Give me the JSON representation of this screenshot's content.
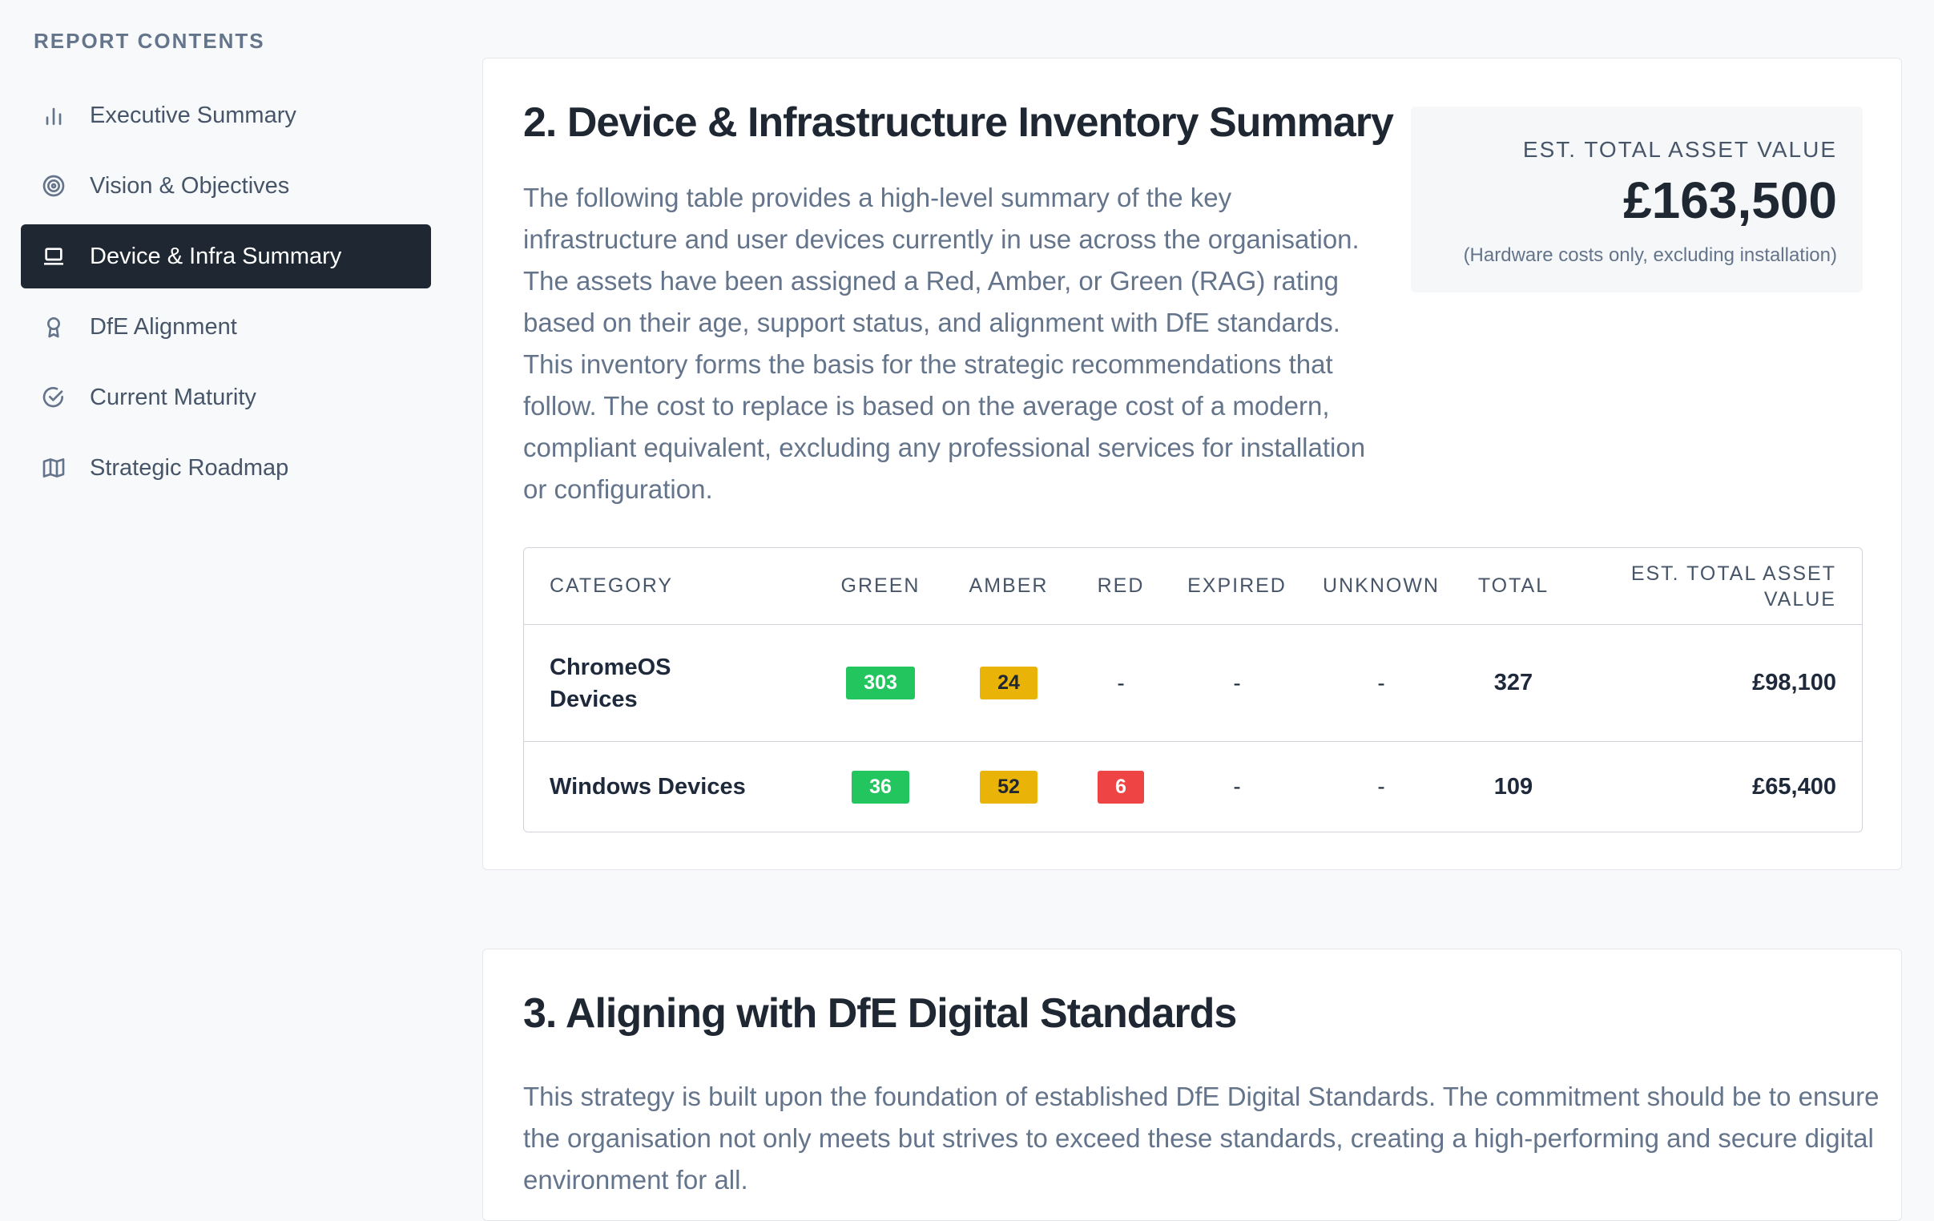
{
  "sidebar": {
    "heading": "REPORT CONTENTS",
    "items": [
      {
        "label": "Executive Summary",
        "icon": "bar-chart-icon"
      },
      {
        "label": "Vision & Objectives",
        "icon": "target-icon"
      },
      {
        "label": "Device & Infra Summary",
        "icon": "laptop-icon",
        "active": true
      },
      {
        "label": "DfE Alignment",
        "icon": "award-icon"
      },
      {
        "label": "Current Maturity",
        "icon": "check-circle-icon"
      },
      {
        "label": "Strategic Roadmap",
        "icon": "map-icon"
      }
    ]
  },
  "section2": {
    "title": "2. Device & Infrastructure Inventory Summary",
    "intro": "The following table provides a high-level summary of the key infrastructure and user devices currently in use across the organisation. The assets have been assigned a Red, Amber, or Green (RAG) rating based on their age, support status, and alignment with DfE standards. This inventory forms the basis for the strategic recommendations that follow. The cost to replace is based on the average cost of a modern, compliant equivalent, excluding any professional services for installation or configuration.",
    "value_box": {
      "label": "EST. TOTAL ASSET VALUE",
      "amount": "£163,500",
      "note": "(Hardware costs only, excluding installation)"
    },
    "table": {
      "headers": [
        "CATEGORY",
        "GREEN",
        "AMBER",
        "RED",
        "EXPIRED",
        "UNKNOWN",
        "TOTAL",
        "EST. TOTAL ASSET VALUE"
      ],
      "rows": [
        {
          "category": "ChromeOS Devices",
          "green": "303",
          "amber": "24",
          "red": "-",
          "expired": "-",
          "unknown": "-",
          "total": "327",
          "value": "£98,100"
        },
        {
          "category": "Windows Devices",
          "green": "36",
          "amber": "52",
          "red": "6",
          "expired": "-",
          "unknown": "-",
          "total": "109",
          "value": "£65,400"
        }
      ]
    }
  },
  "section3": {
    "title": "3. Aligning with DfE Digital Standards",
    "intro": "This strategy is built upon the foundation of established DfE Digital Standards. The commitment should be to ensure the organisation not only meets but strives to exceed these standards, creating a high-performing and secure digital environment for all."
  },
  "colors": {
    "green": "#22c55e",
    "amber": "#eab308",
    "red": "#ef4444",
    "active_nav": "#1e2732"
  }
}
